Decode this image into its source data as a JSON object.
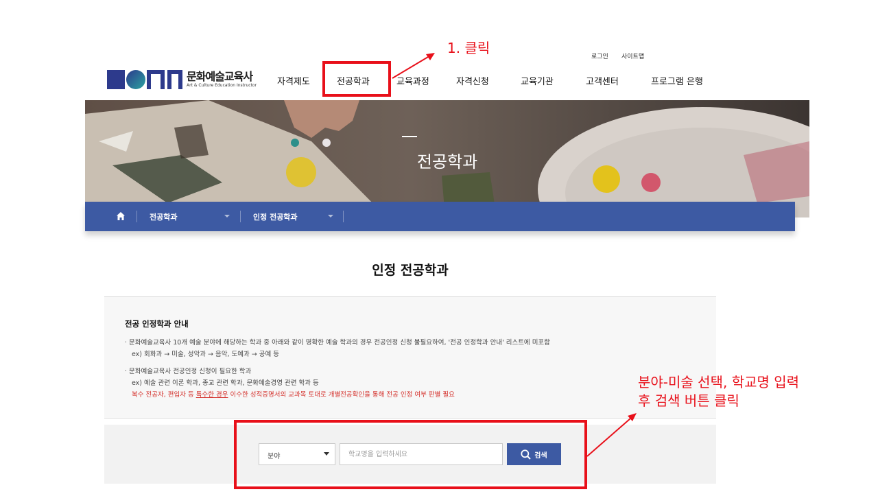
{
  "header": {
    "logo_text_ko": "문화예술교육사",
    "logo_text_en": "Art & Culture Education Instructor",
    "util_links": [
      "로그인",
      "사이트맵"
    ],
    "nav_items": [
      "자격제도",
      "전공학과",
      "교육과정",
      "자격신청",
      "교육기관",
      "고객센터",
      "프로그램 은행"
    ]
  },
  "hero": {
    "title": "전공학과"
  },
  "breadcrumb": {
    "home_icon": "home-icon",
    "items": [
      "전공학과",
      "인정 전공학과"
    ]
  },
  "page_title": "인정 전공학과",
  "info": {
    "title": "전공 인정학과 안내",
    "line1": "· 문화예술교육사 10개 예술 분야에 해당하는 학과 중 아래와 같이 명확한 예술 학과의 경우 전공인정 신청 불필요하여, '전공 인정학과 안내' 리스트에 미포함",
    "line1_ex": "ex) 회화과 → 미술, 성악과 → 음악, 도예과 → 공예 등",
    "line2": "· 문화예술교육사 전공인정 신청이 필요한 학과",
    "line2_ex": "ex) 예술 관련 이론 학과, 종교 관련 학과, 문화예술경영 관련 학과 등",
    "notice_pre": "복수 전공자, 편입자 등 ",
    "notice_underline": "특수한 경우",
    "notice_post": " 이수한 성적증명서의 교과목 토대로 개별전공확인을 통해 전공 인정 여부 판별 필요"
  },
  "search": {
    "field_select_value": "분야",
    "school_placeholder": "학교명을 입력하세요",
    "button_label": "검색",
    "button_icon": "search-icon"
  },
  "annotations": {
    "step1": "1. 클릭",
    "step2_line1": "분야-미술 선택, 학교명 입력",
    "step2_line2": "후 검색 버튼 클릭",
    "color": "#e8101a"
  },
  "colors": {
    "brand_blue": "#3d5aa3",
    "logo_navy": "#2d3a8c",
    "annotation_red": "#e8101a"
  }
}
